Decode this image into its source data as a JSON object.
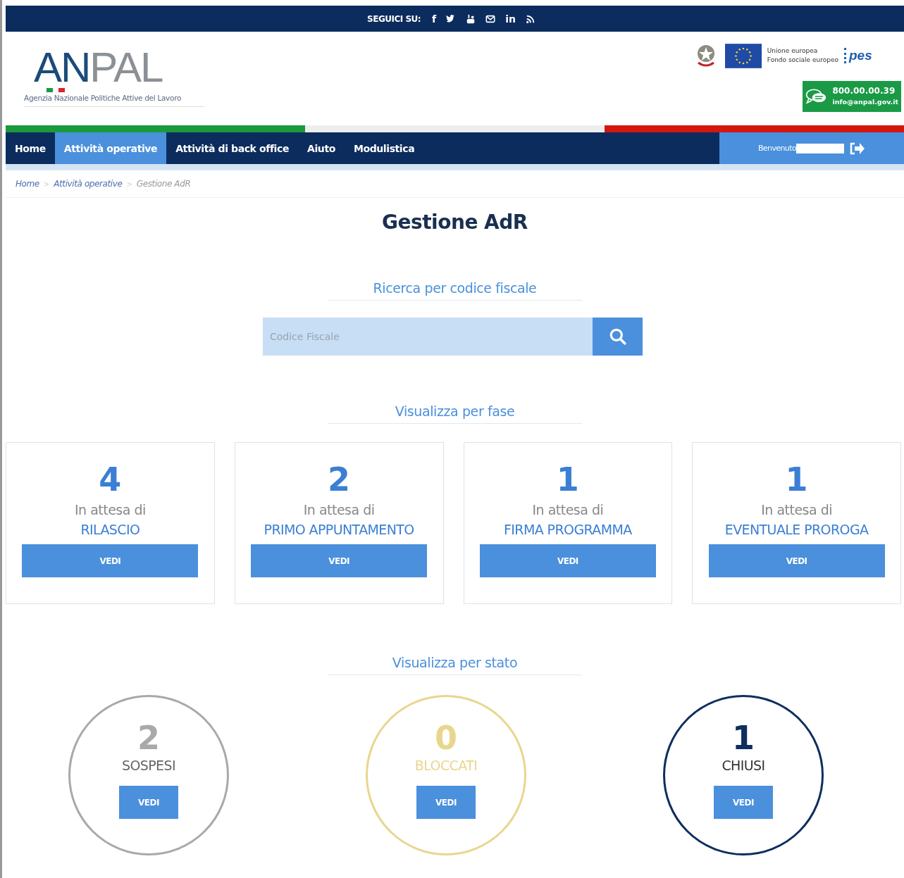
{
  "top_bar": {
    "label": "SEGUICI SU:",
    "social": [
      {
        "kind": "text",
        "label": "f"
      },
      {
        "kind": "twitter"
      },
      {
        "kind": "youtube"
      },
      {
        "kind": "mail"
      },
      {
        "kind": "text",
        "label": "in"
      },
      {
        "kind": "rss"
      }
    ]
  },
  "header": {
    "logo": {
      "primary": "AN",
      "secondary": "PAL",
      "tagline": "Agenzia Nazionale Politiche Attive del Lavoro"
    },
    "eu_text": [
      "Unione europea",
      "Fondo sociale europeo"
    ],
    "pes": "pes",
    "contact": {
      "phone": "800.00.00.39",
      "email": "info@anpal.gov.it"
    }
  },
  "nav": {
    "items": [
      {
        "label": "Home",
        "selected": false
      },
      {
        "label": "Attività operative",
        "selected": true
      },
      {
        "label": "Attività di back office",
        "selected": false
      },
      {
        "label": "Aiuto",
        "selected": false
      },
      {
        "label": "Modulistica",
        "selected": false
      }
    ],
    "welcome": "Benvenuto"
  },
  "breadcrumb_separator": ">",
  "breadcrumb": [
    {
      "label": "Home",
      "current": false
    },
    {
      "label": "Attività operative",
      "current": false
    },
    {
      "label": "Gestione AdR",
      "current": true
    }
  ],
  "title": "Gestione AdR",
  "search": {
    "heading": "Ricerca per codice fiscale",
    "placeholder": "Codice Fiscale"
  },
  "phases": {
    "heading": "Visualizza per fase",
    "cards": [
      {
        "count": "4",
        "caption": "In attesa di",
        "phase": "RILASCIO",
        "button": "VEDI"
      },
      {
        "count": "2",
        "caption": "In attesa di",
        "phase": "PRIMO APPUNTAMENTO",
        "button": "VEDI"
      },
      {
        "count": "1",
        "caption": "In attesa di",
        "phase": "FIRMA PROGRAMMA",
        "button": "VEDI"
      },
      {
        "count": "1",
        "caption": "In attesa di",
        "phase": "EVENTUALE PROROGA",
        "button": "VEDI"
      }
    ]
  },
  "states": {
    "heading": "Visualizza per stato",
    "items": [
      {
        "count": "2",
        "label": "SOSPESI",
        "color": "#a9a9a9",
        "button": "VEDI"
      },
      {
        "count": "0",
        "label": "BLOCCATI",
        "color": "#e9d68e",
        "button": "VEDI"
      },
      {
        "count": "1",
        "label": "CHIUSI",
        "color": "#0e2e5f",
        "button": "VEDI"
      }
    ]
  }
}
